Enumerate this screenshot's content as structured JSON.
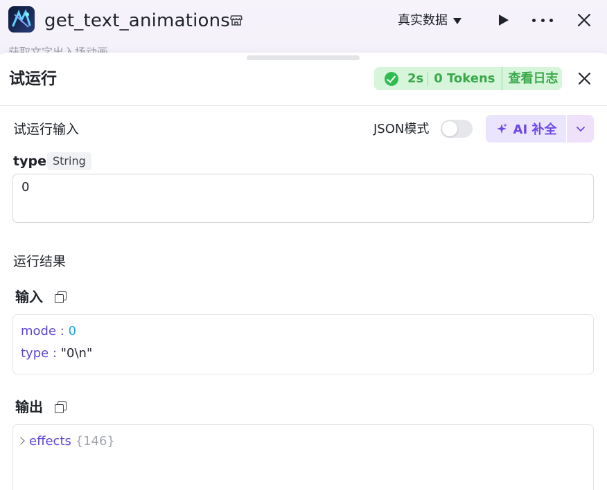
{
  "header": {
    "title": "get_text_animations",
    "subtitle": "获取文字出入场动画",
    "data_mode": "真实数据"
  },
  "panel": {
    "title": "试运行",
    "status": {
      "duration": "2s",
      "tokens": "0 Tokens",
      "log_link": "查看日志"
    }
  },
  "input_section": {
    "title": "试运行输入",
    "json_mode_label": "JSON模式",
    "json_mode_on": false,
    "ai_button": "AI 补全",
    "field": {
      "name": "type",
      "type_tag": "String",
      "value": "0"
    }
  },
  "result_section": {
    "title": "运行结果",
    "input_label": "输入",
    "input_rows": [
      {
        "key": "mode",
        "value": "0"
      },
      {
        "key": "type",
        "value": "\"0\\n\""
      }
    ],
    "output_label": "输出",
    "output_rows": [
      {
        "key": "effects",
        "meta": "{146}"
      }
    ]
  },
  "colors": {
    "accent": "#6b47e6",
    "success": "#2ebd4e",
    "key": "#5b47d6",
    "number": "#1da7d8"
  }
}
